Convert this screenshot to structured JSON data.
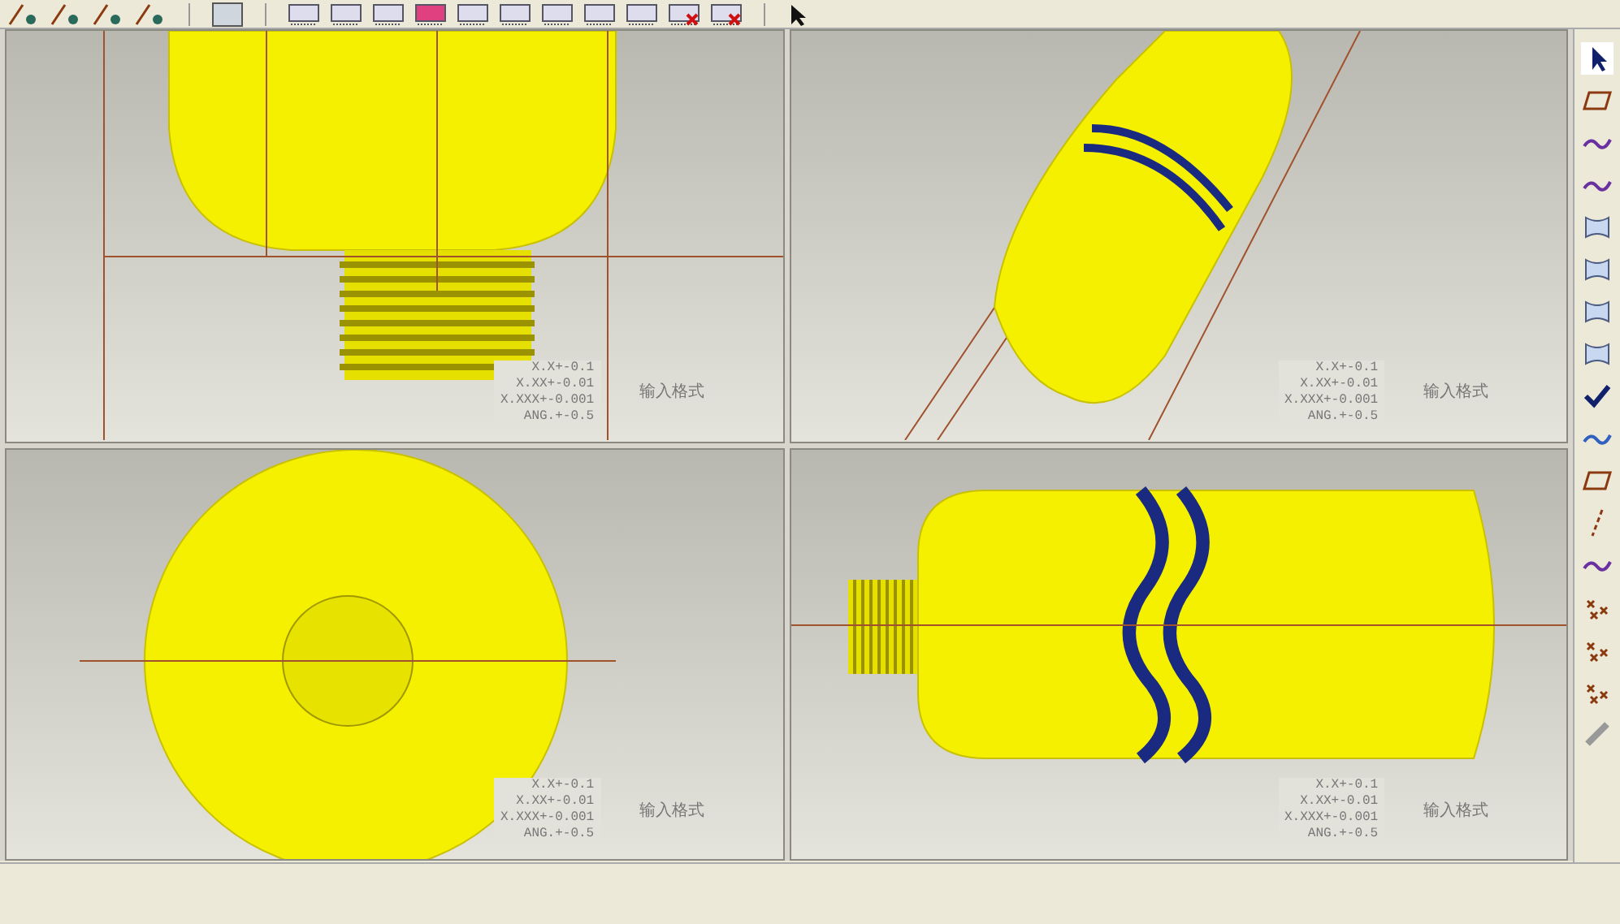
{
  "viewports": [
    {
      "kind": "front",
      "tolerances": [
        "X.X+-0.1",
        "X.XX+-0.01",
        "X.XXX+-0.001",
        "ANG.+-0.5"
      ],
      "mode_label": "输入格式"
    },
    {
      "kind": "iso",
      "tolerances": [
        "X.X+-0.1",
        "X.XX+-0.01",
        "X.XXX+-0.001",
        "ANG.+-0.5"
      ],
      "mode_label": "输入格式"
    },
    {
      "kind": "bottom",
      "tolerances": [
        "X.X+-0.1",
        "X.XX+-0.01",
        "X.XXX+-0.001",
        "ANG.+-0.5"
      ],
      "mode_label": "输入格式"
    },
    {
      "kind": "side",
      "tolerances": [
        "X.X+-0.1",
        "X.XX+-0.01",
        "X.XXX+-0.001",
        "ANG.+-0.5"
      ],
      "mode_label": "输入格式"
    }
  ]
}
